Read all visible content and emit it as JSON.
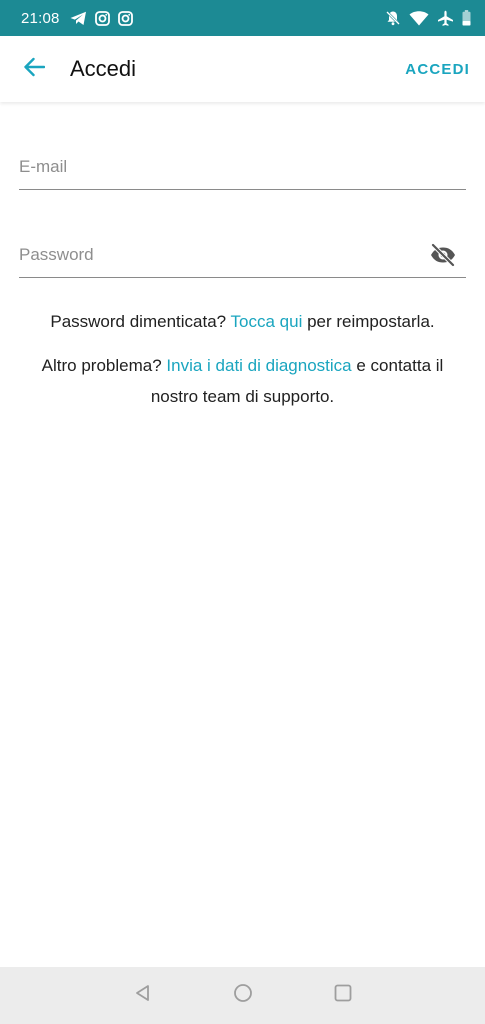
{
  "status_bar": {
    "time": "21:08",
    "left_icons": [
      "telegram-icon",
      "instagram-icon",
      "instagram-icon"
    ],
    "right_icons": [
      "notifications-off-icon",
      "wifi-icon",
      "airplane-icon",
      "battery-icon"
    ],
    "background": "#1c8a94"
  },
  "app_bar": {
    "back_icon": "arrow-left-icon",
    "title": "Accedi",
    "action_label": "ACCEDI"
  },
  "form": {
    "email": {
      "placeholder": "E-mail",
      "value": ""
    },
    "password": {
      "placeholder": "Password",
      "value": "",
      "toggle_icon": "eye-off-icon"
    }
  },
  "help": {
    "forgot_prefix": "Password dimenticata? ",
    "forgot_link": "Tocca qui",
    "forgot_suffix": " per reimpostarla.",
    "other_prefix": "Altro problema? ",
    "other_link": "Invia i dati di diagnostica",
    "other_suffix": " e contatta il nostro team di supporto."
  },
  "nav_bar": {
    "buttons": [
      "back-triangle-icon",
      "home-circle-icon",
      "recents-square-icon"
    ]
  },
  "colors": {
    "accent": "#1aa5bf",
    "status_bar": "#1c8a94",
    "nav_bar": "#ececec"
  }
}
